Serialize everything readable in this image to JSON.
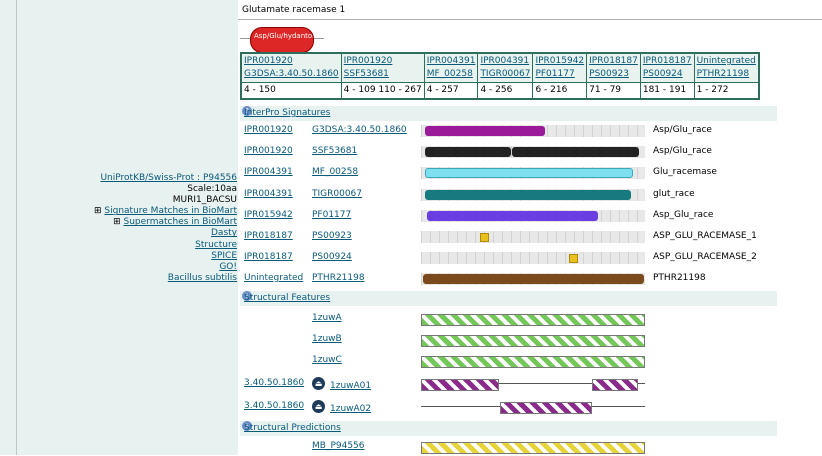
{
  "left": {
    "uniprot_prefix": "UniProtKB/Swiss-Prot : ",
    "uniprot_id": "P94556",
    "scale": "Scale:10aa",
    "entry_name": "MURI1_BACSU",
    "links": [
      "Signature Matches in BioMart",
      "Supermatches in BioMart",
      "Dasty",
      "Structure",
      "SPICE",
      "GO!",
      "Bacillus subtilis"
    ]
  },
  "title": "Glutamate racemase 1",
  "pill_label": "Asp/Glu/hydantoin",
  "match_table": {
    "entries": [
      "IPR001920",
      "IPR001920",
      "IPR004391",
      "IPR004391",
      "IPR015942",
      "IPR018187",
      "IPR018187",
      "Unintegrated"
    ],
    "signatures": [
      "G3DSA:3.40.50.1860",
      "SSF53681",
      "MF_00258",
      "TIGR00067",
      "PF01177",
      "PS00923",
      "PS00924",
      "PTHR21198"
    ],
    "ranges": [
      "4 - 150",
      "4 - 109 110 - 267",
      "4 - 257",
      "4 - 256",
      "6 - 216",
      "71 - 79",
      "181 - 191",
      "1 - 272"
    ]
  },
  "sections": {
    "interpro": "InterPro Signatures",
    "structural_features": "Structural Features",
    "structural_predictions": "Structural Predictions"
  },
  "help_glyph": "?",
  "signature_rows": [
    {
      "entry": "IPR001920",
      "sig": "G3DSA:3.40.50.1860",
      "label": "Asp/Glu_race",
      "color": "#9a1a9a"
    },
    {
      "entry": "IPR001920",
      "sig": "SSF53681",
      "label": "Asp/Glu_race",
      "color": "#222222"
    },
    {
      "entry": "IPR004391",
      "sig": "MF_00258",
      "label": "Glu_racemase",
      "color": "#7ee0ee"
    },
    {
      "entry": "IPR004391",
      "sig": "TIGR00067",
      "label": "glut_race",
      "color": "#167a7e"
    },
    {
      "entry": "IPR015942",
      "sig": "PF01177",
      "label": "Asp_Glu_race",
      "color": "#6a3de0"
    },
    {
      "entry": "IPR018187",
      "sig": "PS00923",
      "label": "ASP_GLU_RACEMASE_1",
      "color": "#e8c020"
    },
    {
      "entry": "IPR018187",
      "sig": "PS00924",
      "label": "ASP_GLU_RACEMASE_2",
      "color": "#e8c020"
    },
    {
      "entry": "Unintegrated",
      "sig": "PTHR21198",
      "label": "PTHR21198",
      "color": "#7a4a1e"
    }
  ],
  "structure_rows": [
    {
      "domain": "",
      "id": "1zuwA"
    },
    {
      "domain": "",
      "id": "1zuwB"
    },
    {
      "domain": "",
      "id": "1zuwC"
    },
    {
      "domain": "3.40.50.1860",
      "id": "1zuwA01"
    },
    {
      "domain": "3.40.50.1860",
      "id": "1zuwA02"
    }
  ],
  "prediction_rows": [
    {
      "id": "MB_P94556"
    }
  ]
}
